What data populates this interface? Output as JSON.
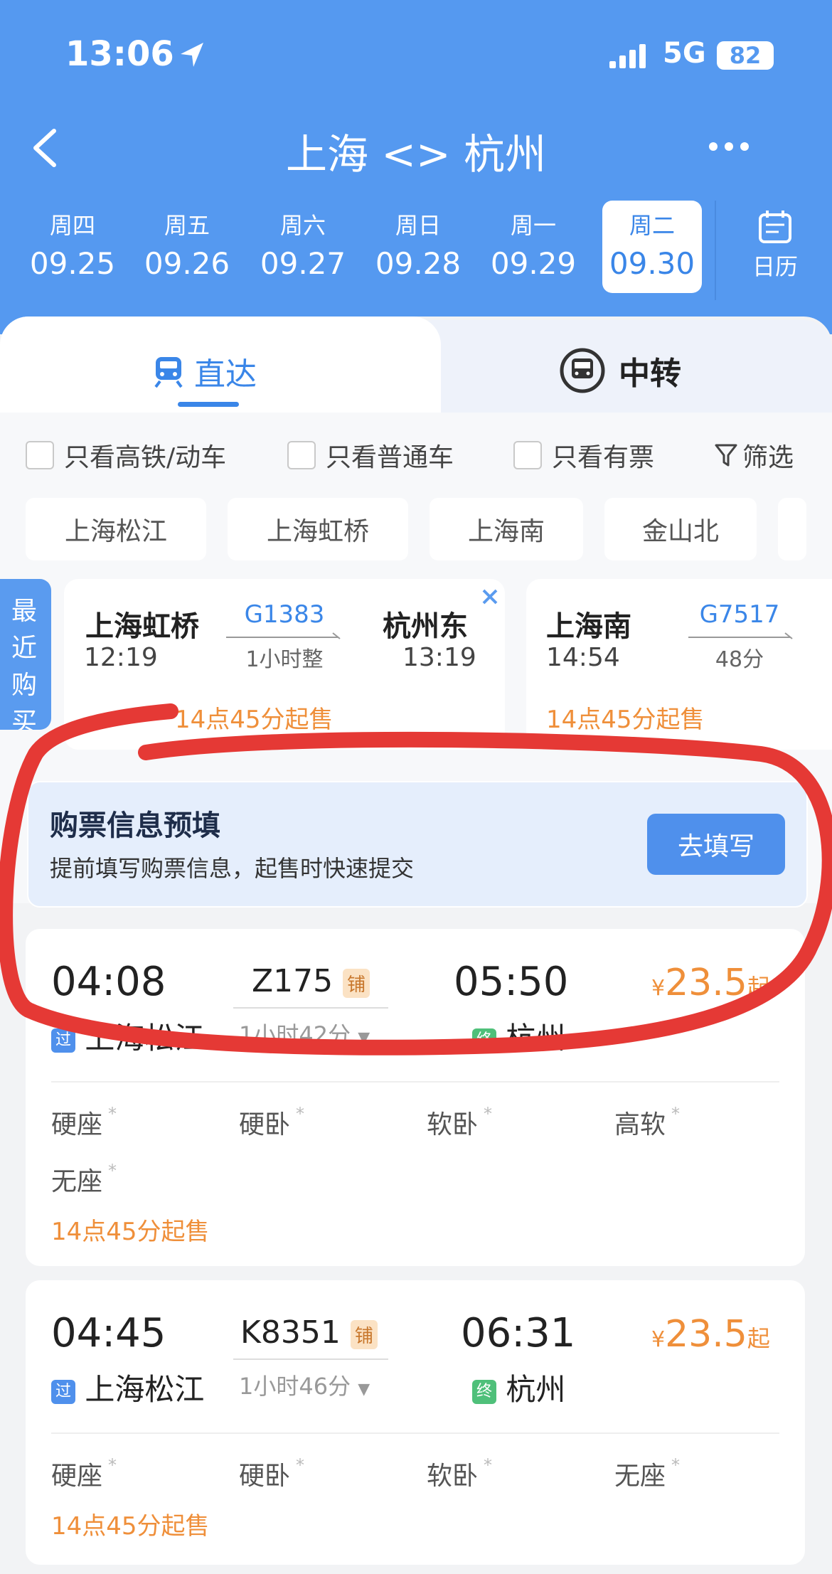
{
  "status_bar": {
    "time": "13:06",
    "network": "5G",
    "battery": "82"
  },
  "nav": {
    "back_icon": "chevron-left-icon",
    "title": "上海 <> 杭州",
    "more_icon": "more-dots-icon"
  },
  "dates": [
    {
      "weekday": "周四",
      "date": "09.25"
    },
    {
      "weekday": "周五",
      "date": "09.26"
    },
    {
      "weekday": "周六",
      "date": "09.27"
    },
    {
      "weekday": "周日",
      "date": "09.28"
    },
    {
      "weekday": "周一",
      "date": "09.29"
    },
    {
      "weekday": "周二",
      "date": "09.30"
    }
  ],
  "selected_date_index": 5,
  "calendar_label": "日历",
  "modes": {
    "direct": "直达",
    "transfer": "中转"
  },
  "filters": {
    "high_speed": "只看高铁/动车",
    "normal": "只看普通车",
    "available": "只看有票",
    "filter": "筛选"
  },
  "stations": [
    "上海松江",
    "上海虹桥",
    "上海南",
    "金山北"
  ],
  "recent_label": "最近购买",
  "recent": [
    {
      "from": "上海虹桥",
      "train": "G1383",
      "duration": "1小时整",
      "to": "杭州东",
      "dep": "12:19",
      "arr": "13:19",
      "sale": "14点45分起售"
    },
    {
      "from": "上海南",
      "train": "G7517",
      "duration": "48分",
      "dep": "14:54",
      "sale": "14点45分起售"
    }
  ],
  "prefill": {
    "title": "购票信息预填",
    "desc": "提前填写购票信息，起售时快速提交",
    "button": "去填写"
  },
  "trains": [
    {
      "dep": "04:08",
      "train": "Z175",
      "tag": "铺",
      "arr": "05:50",
      "currency": "¥",
      "price": "23.5",
      "price_suffix": "起",
      "from_badge": "过",
      "from": "上海松江",
      "duration": "1小时42分",
      "to_badge": "终",
      "to": "杭州",
      "seats": [
        "硬座",
        "硬卧",
        "软卧",
        "高软",
        "无座"
      ],
      "seat_mark": "*",
      "sale": "14点45分起售"
    },
    {
      "dep": "04:45",
      "train": "K8351",
      "tag": "铺",
      "arr": "06:31",
      "currency": "¥",
      "price": "23.5",
      "price_suffix": "起",
      "from_badge": "过",
      "from": "上海松江",
      "duration": "1小时46分",
      "to_badge": "终",
      "to": "杭州",
      "seats": [
        "硬座",
        "硬卧",
        "软卧",
        "无座"
      ],
      "seat_mark": "*",
      "sale": "14点45分起售"
    }
  ],
  "colors": {
    "header": "#5599f0",
    "accent": "#3a86e8",
    "orange": "#ef8f3a",
    "annotation_red": "#e53935"
  }
}
